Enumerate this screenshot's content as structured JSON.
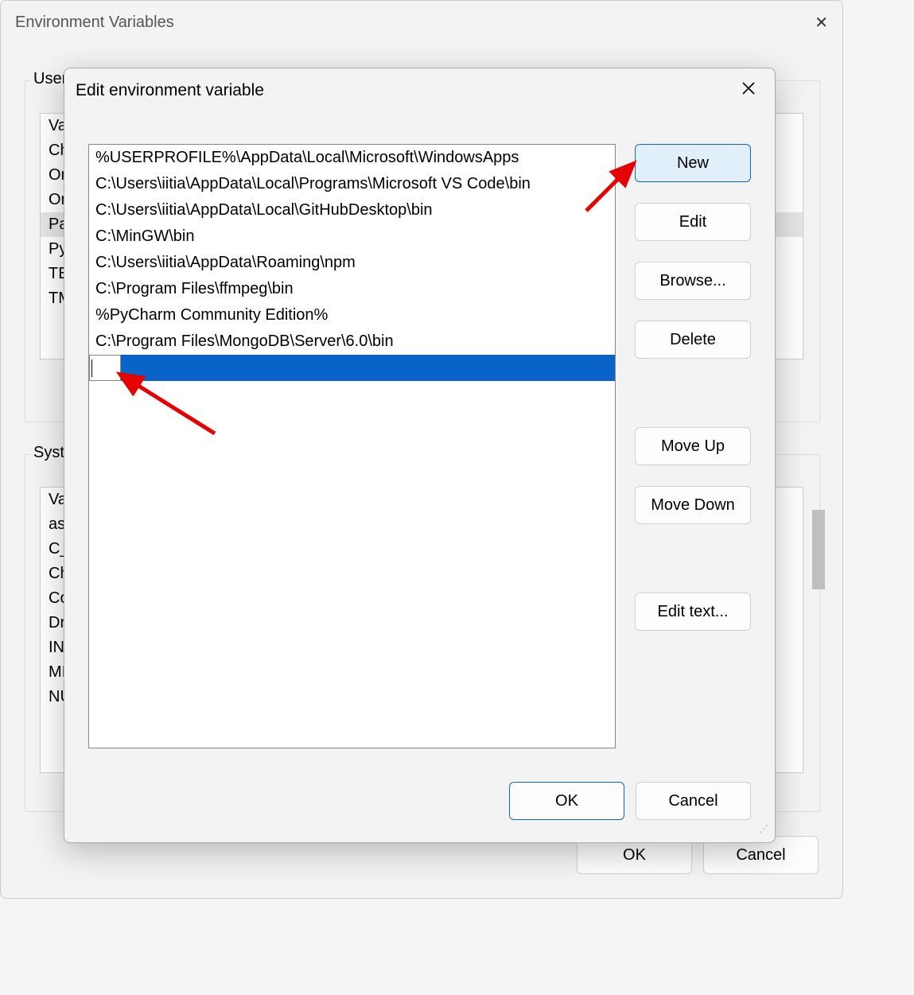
{
  "parent_dialog": {
    "title": "Environment Variables",
    "user_section_label": "User",
    "system_section_label": "Syste",
    "user_vars": [
      "Var",
      "Ch",
      "On",
      "On",
      "Pat",
      "PyC",
      "TEM",
      "TM"
    ],
    "user_selected_index": 4,
    "system_vars": [
      "Var",
      "asl",
      "C_E",
      "Ch",
      "Co",
      "Dri",
      "INT",
      "MI",
      "NU"
    ],
    "ok_label": "OK",
    "cancel_label": "Cancel"
  },
  "edit_dialog": {
    "title": "Edit environment variable",
    "paths": [
      "%USERPROFILE%\\AppData\\Local\\Microsoft\\WindowsApps",
      "C:\\Users\\iitia\\AppData\\Local\\Programs\\Microsoft VS Code\\bin",
      "C:\\Users\\iitia\\AppData\\Local\\GitHubDesktop\\bin",
      "C:\\MinGW\\bin",
      "C:\\Users\\iitia\\AppData\\Roaming\\npm",
      "C:\\Program Files\\ffmpeg\\bin",
      "%PyCharm Community Edition%",
      "C:\\Program Files\\MongoDB\\Server\\6.0\\bin"
    ],
    "editing_value": "",
    "buttons": {
      "new": "New",
      "edit": "Edit",
      "browse": "Browse...",
      "delete": "Delete",
      "move_up": "Move Up",
      "move_down": "Move Down",
      "edit_text": "Edit text...",
      "ok": "OK",
      "cancel": "Cancel"
    }
  }
}
